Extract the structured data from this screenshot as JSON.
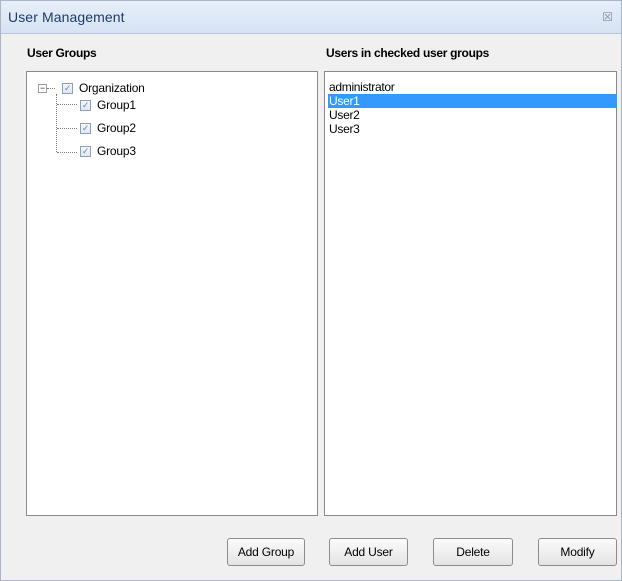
{
  "window": {
    "title": "User Management",
    "close_glyph": "☒"
  },
  "left": {
    "heading": "User Groups",
    "tree": {
      "root": {
        "label": "Organization",
        "expander": "−",
        "checked": true
      },
      "children": [
        {
          "label": "Group1",
          "checked": true
        },
        {
          "label": "Group2",
          "checked": true
        },
        {
          "label": "Group3",
          "checked": true
        }
      ]
    }
  },
  "right": {
    "heading": "Users in checked user groups",
    "users": [
      "administrator",
      "User1",
      "User2",
      "User3"
    ],
    "selected": "User1"
  },
  "buttons": {
    "add_group": "Add Group",
    "add_user": "Add User",
    "delete": "Delete",
    "modify": "Modify"
  },
  "colors": {
    "selection": "#3399ff",
    "title_text": "#1e3b6b"
  },
  "icons": {
    "checkbox": "check-icon",
    "expander": "minus-icon",
    "close": "close-icon"
  }
}
